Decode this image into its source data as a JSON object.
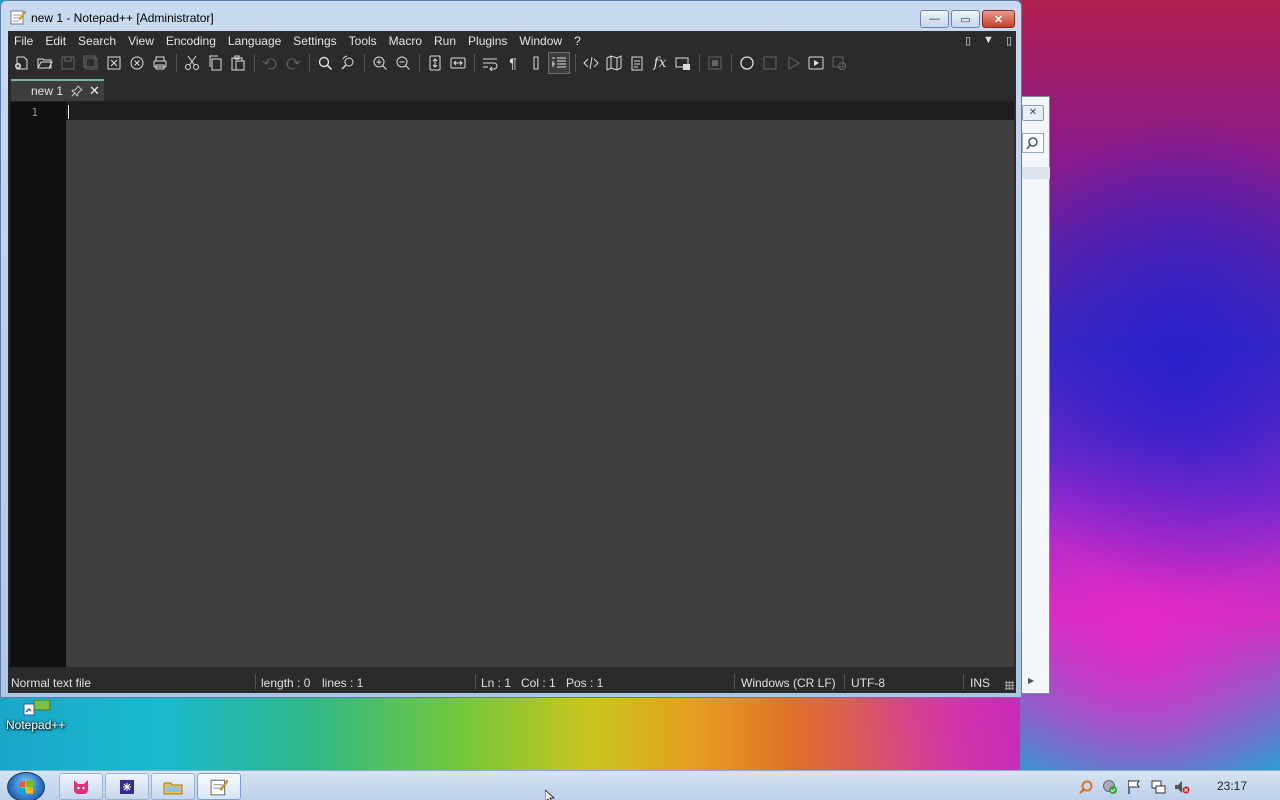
{
  "window": {
    "title": "new 1 - Notepad++ [Administrator]",
    "minimize_glyph": "—",
    "maximize_glyph": "▭",
    "close_glyph": "✕"
  },
  "menu": {
    "items": [
      "File",
      "Edit",
      "Search",
      "View",
      "Encoding",
      "Language",
      "Settings",
      "Tools",
      "Macro",
      "Run",
      "Plugins",
      "Window",
      "?"
    ],
    "right_glyphs": [
      "▯",
      "▼",
      "▯"
    ]
  },
  "toolbar": {
    "icons": [
      "new-file-icon",
      "open-file-icon",
      "save-icon",
      "save-all-icon",
      "close-icon",
      "close-all-icon",
      "print-icon",
      "cut-icon",
      "copy-icon",
      "paste-icon",
      "undo-icon",
      "redo-icon",
      "find-icon",
      "replace-icon",
      "zoom-in-icon",
      "zoom-out-icon",
      "sync-vertical-icon",
      "sync-horizontal-icon",
      "word-wrap-icon",
      "show-all-chars-icon",
      "indent-guide-icon",
      "user-defined-language-icon",
      "xml-tag-icon",
      "document-map-icon",
      "document-list-icon",
      "function-list-icon",
      "folder-as-workspace-icon",
      "monitoring-icon",
      "record-macro-icon",
      "stop-record-icon",
      "play-macro-icon",
      "run-macro-multiple-icon",
      "save-macro-icon"
    ]
  },
  "tabs": [
    {
      "label": "new 1",
      "pin_icon": "pin-icon",
      "close_glyph": "✕"
    }
  ],
  "editor": {
    "line_numbers": [
      "1"
    ],
    "content": ""
  },
  "status": {
    "file_type": "Normal text file",
    "length": "length : 0",
    "lines": "lines : 1",
    "ln": "Ln : 1",
    "col": "Col : 1",
    "pos": "Pos : 1",
    "eol": "Windows (CR LF)",
    "encoding": "UTF-8",
    "mode": "INS"
  },
  "desktop": {
    "icon_label": "Notepad++"
  },
  "taskbar": {
    "apps": [
      "cat-app-icon",
      "terminal-app-icon",
      "file-explorer-icon",
      "notepad-plus-plus-icon"
    ],
    "tray": [
      "search-tray-icon",
      "security-tray-icon",
      "flag-tray-icon",
      "network-tray-icon",
      "volume-muted-icon"
    ],
    "clock": "23:17"
  },
  "colors": {
    "editor_bg": "#3f3f3f",
    "gutter_bg": "#101010",
    "menu_bg": "#2b2b2b",
    "tab_accent": "#7fb3a5"
  }
}
